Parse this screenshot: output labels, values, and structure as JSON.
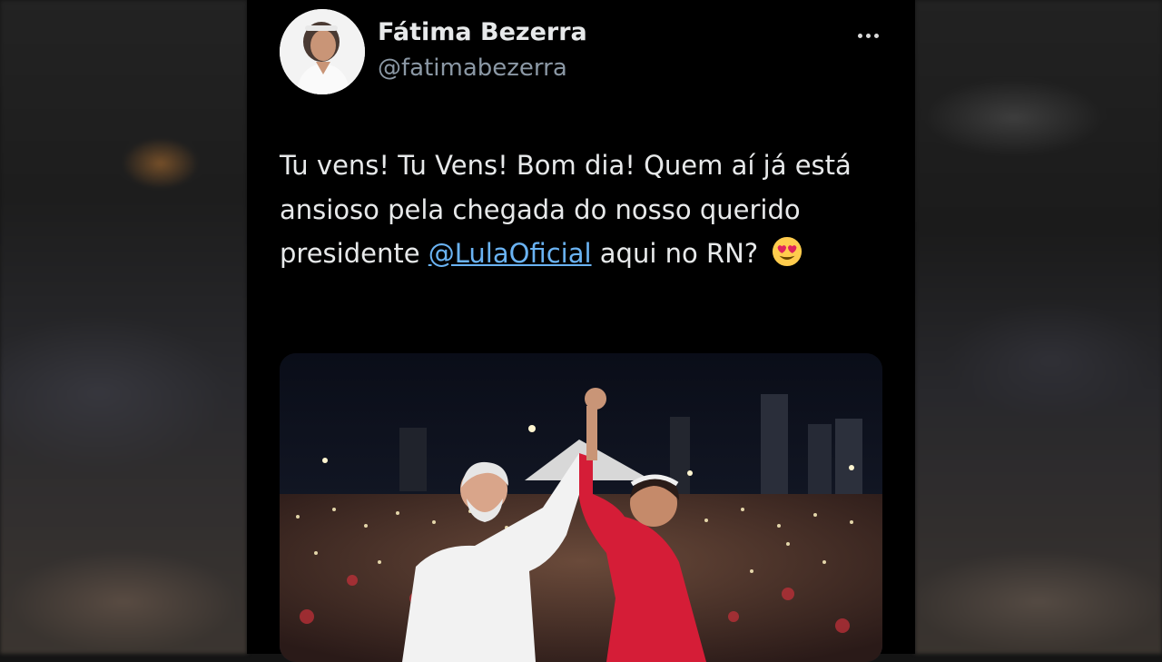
{
  "tweet": {
    "author_name": "Fátima Bezerra",
    "author_handle": "@fatimabezerra",
    "text_before": "Tu vens! Tu Vens! Bom dia! Quem aí já está ansioso pela chegada do nosso querido presidente ",
    "mention": "@LulaOficial",
    "text_after": " aqui no RN? ",
    "emoji": "heart-eyes-emoji",
    "more_icon": "more-options-icon",
    "media_description_icon": "photo"
  },
  "colors": {
    "background": "#000000",
    "text": "#e7e9ea",
    "handle": "#8b98a5",
    "mention": "#6ab3f3"
  }
}
